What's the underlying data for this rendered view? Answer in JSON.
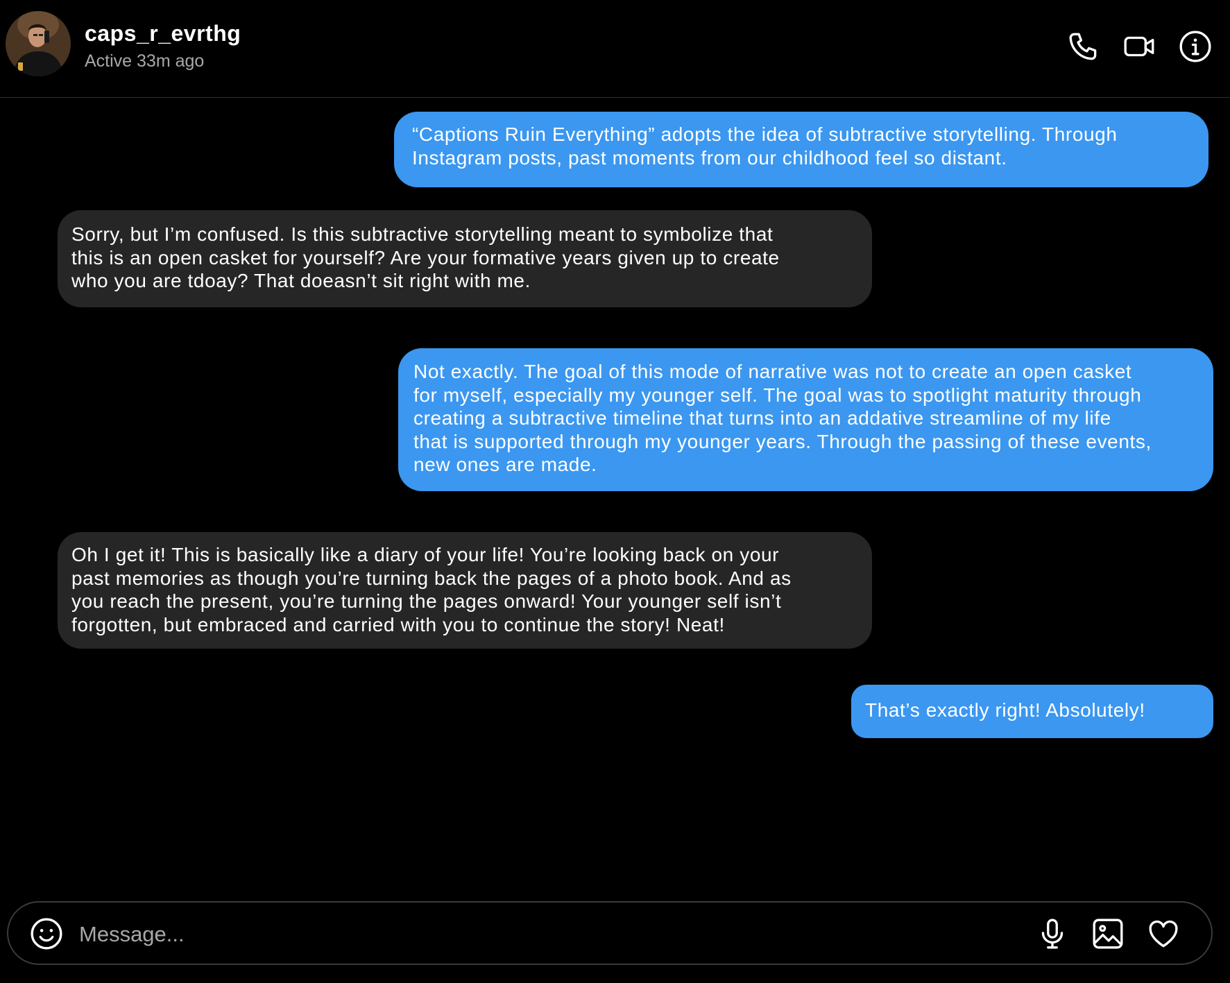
{
  "header": {
    "username": "caps_r_evrthg",
    "status": "Active 33m ago",
    "icons": [
      "phone-icon",
      "video-camera-icon",
      "info-icon"
    ]
  },
  "messages": [
    {
      "from": "me",
      "lines": [
        "“Captions Ruin Everything” adopts the idea of subtractive storytelling. Through",
        "Instagram posts, past moments from our childhood feel so distant."
      ]
    },
    {
      "from": "them",
      "lines": [
        "Sorry, but I’m confused. Is this subtractive storytelling meant to symbolize that",
        "this is an open casket for yourself? Are your formative years given up to create",
        "who you are tdoay? That doeasn’t sit right with me."
      ]
    },
    {
      "from": "me",
      "lines": [
        "Not exactly.  The goal of this mode of narrative was not to create an open casket",
        "for myself, especially my younger self. The goal was to spotlight maturity through",
        "creating a subtractive timeline that turns into an addative streamline of my life",
        "that is supported through my younger years. Through the passing of these events,",
        "new ones are made."
      ]
    },
    {
      "from": "them",
      "lines": [
        "Oh I get it! This is basically like a diary of your life! You’re looking back on your",
        "past memories as though you’re turning back the pages of a photo book. And as",
        "you reach the present, you’re turning the pages onward! Your younger self isn’t",
        "forgotten, but embraced and carried with you to continue the story! Neat!"
      ]
    },
    {
      "from": "me",
      "lines": [
        "That’s exactly right! Absolutely!"
      ]
    }
  ],
  "composer": {
    "placeholder": "Message...",
    "icons": [
      "emoji-icon",
      "microphone-icon",
      "image-icon",
      "heart-icon"
    ]
  },
  "colors": {
    "background": "#000000",
    "sent_bubble": "#3b97f0",
    "received_bubble": "#262626",
    "secondary_text": "#a8a8a8"
  }
}
